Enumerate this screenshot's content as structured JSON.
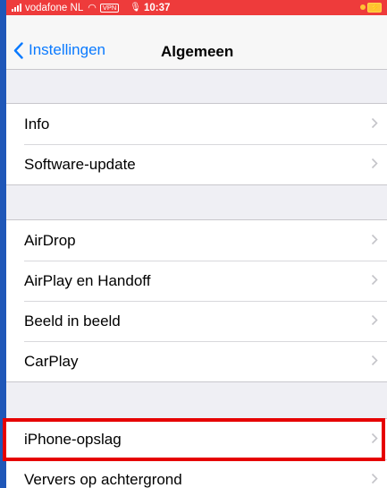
{
  "status_bar": {
    "carrier": "vodafone NL",
    "vpn": "VPN",
    "time": "10:37"
  },
  "nav": {
    "back_label": "Instellingen",
    "title": "Algemeen"
  },
  "groups": [
    {
      "items": [
        "Info",
        "Software-update"
      ]
    },
    {
      "items": [
        "AirDrop",
        "AirPlay en Handoff",
        "Beeld in beeld",
        "CarPlay"
      ]
    },
    {
      "items": [
        "iPhone-opslag",
        "Ververs op achtergrond"
      ]
    }
  ],
  "highlighted_item": "iPhone-opslag",
  "colors": {
    "status_bar_bg": "#ee3b3b",
    "link_blue": "#0a7aff",
    "highlight_red": "#e60000",
    "frame_border": "#1f57b8"
  }
}
